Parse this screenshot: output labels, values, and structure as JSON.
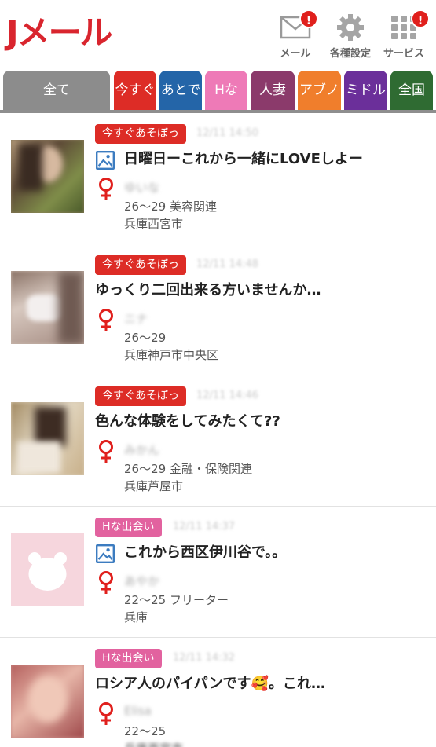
{
  "header": {
    "logo_text": "Jメール",
    "buttons": [
      {
        "label": "メール",
        "icon": "mail-icon",
        "badge": "!"
      },
      {
        "label": "各種設定",
        "icon": "gear-icon",
        "badge": ""
      },
      {
        "label": "サービス",
        "icon": "grid-icon",
        "badge": "!"
      }
    ]
  },
  "tabs": [
    {
      "label": "全て",
      "color": "#8c8c8c"
    },
    {
      "label": "今すぐ",
      "color": "#dd2c26"
    },
    {
      "label": "あとで",
      "color": "#2465a8"
    },
    {
      "label": "Hな",
      "color": "#ee7ab7"
    },
    {
      "label": "人妻",
      "color": "#8b3a6b"
    },
    {
      "label": "アブノ",
      "color": "#f07e2c"
    },
    {
      "label": "ミドル",
      "color": "#6b2f9a"
    },
    {
      "label": "全国",
      "color": "#2f6b32"
    }
  ],
  "posts": [
    {
      "category": "今すぐあそぼっ",
      "category_color": "#dd2c26",
      "time": "12/11 14:50",
      "has_image": true,
      "title": "日曜日ーこれから一緒にLOVEしよー",
      "name": "ゆいな",
      "age_job": "26～29 美容関連",
      "area": "兵庫西宮市",
      "thumb": "photo-warm"
    },
    {
      "category": "今すぐあそぼっ",
      "category_color": "#dd2c26",
      "time": "12/11 14:48",
      "has_image": false,
      "title": "ゆっくり二回出来る方いませんか…",
      "name": "ニナ",
      "age_job": "26～29",
      "area": "兵庫神戸市中央区",
      "thumb": "photo-mask"
    },
    {
      "category": "今すぐあそぼっ",
      "category_color": "#dd2c26",
      "time": "12/11 14:46",
      "has_image": false,
      "title": "色んな体験をしてみたくて??",
      "name": "みかん",
      "age_job": "26～29 金融・保険関連",
      "area": "兵庫芦屋市",
      "thumb": "photo-light"
    },
    {
      "category": "Hな出会い",
      "category_color": "#e2629f",
      "time": "12/11 14:37",
      "has_image": true,
      "title": "これから西区伊川谷で。。",
      "name": "あやか",
      "age_job": "22～25 フリーター",
      "area": "兵庫",
      "thumb": "placeholder"
    },
    {
      "category": "Hな出会い",
      "category_color": "#e2629f",
      "time": "12/11 14:32",
      "has_image": false,
      "title": "ロシア人のパイパンです🥰。これ…",
      "name": "Elisa",
      "age_job": "22～25",
      "area": "兵庫西宮市",
      "thumb": "photo-pink"
    }
  ]
}
